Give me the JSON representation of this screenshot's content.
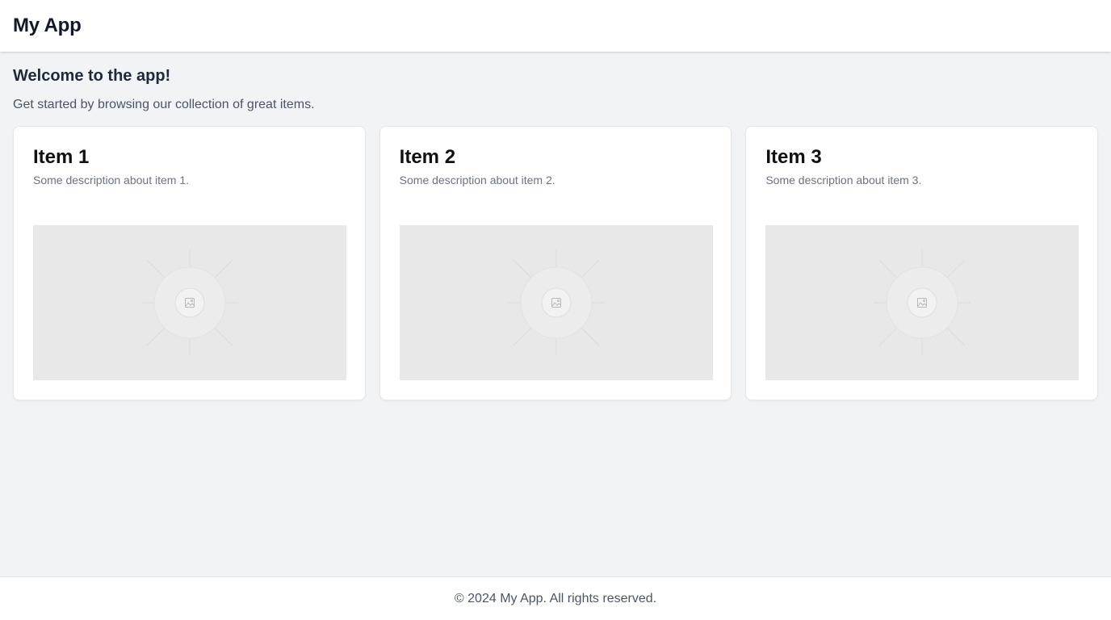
{
  "header": {
    "title": "My App"
  },
  "main": {
    "heading": "Welcome to the app!",
    "subheading": "Get started by browsing our collection of great items."
  },
  "cards": [
    {
      "title": "Item 1",
      "description": "Some description about item 1.",
      "image_icon": "image-placeholder-icon"
    },
    {
      "title": "Item 2",
      "description": "Some description about item 2.",
      "image_icon": "image-placeholder-icon"
    },
    {
      "title": "Item 3",
      "description": "Some description about item 3.",
      "image_icon": "image-placeholder-icon"
    }
  ],
  "footer": {
    "text": "© 2024 My App. All rights reserved."
  },
  "colors": {
    "page_background": "#f2f3f5",
    "surface": "#ffffff",
    "image_placeholder": "#e8e8e8"
  }
}
